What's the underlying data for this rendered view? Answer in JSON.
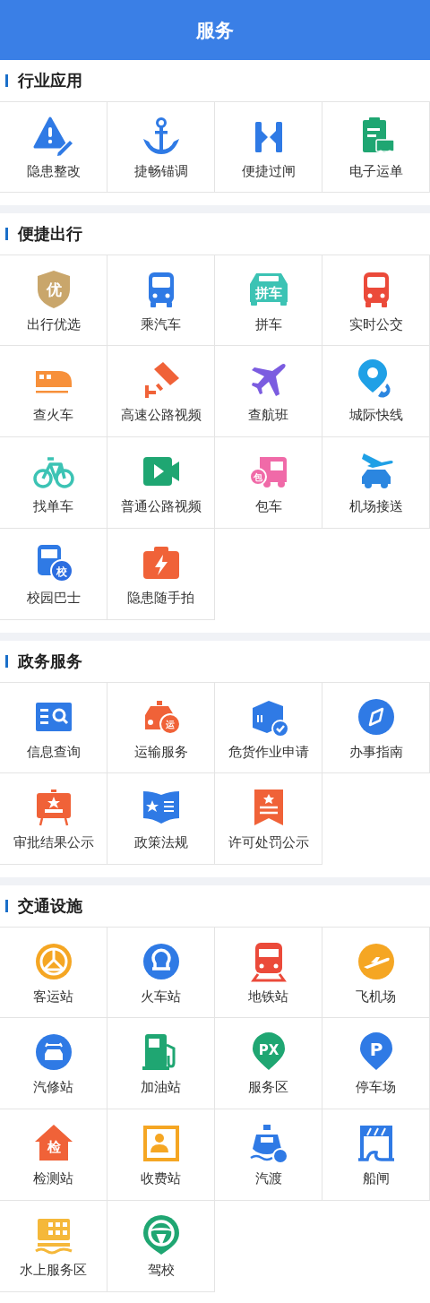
{
  "header": {
    "title": "服务"
  },
  "sections": [
    {
      "title": "行业应用",
      "items": [
        {
          "label": "隐患整改"
        },
        {
          "label": "捷畅锚调"
        },
        {
          "label": "便捷过闸"
        },
        {
          "label": "电子运单"
        }
      ]
    },
    {
      "title": "便捷出行",
      "items": [
        {
          "label": "出行优选",
          "badge": "优"
        },
        {
          "label": "乘汽车"
        },
        {
          "label": "拼车",
          "badge": "拼车"
        },
        {
          "label": "实时公交"
        },
        {
          "label": "查火车"
        },
        {
          "label": "高速公路视频"
        },
        {
          "label": "查航班"
        },
        {
          "label": "城际快线"
        },
        {
          "label": "找单车"
        },
        {
          "label": "普通公路视频"
        },
        {
          "label": "包车",
          "badge": "包"
        },
        {
          "label": "机场接送"
        },
        {
          "label": "校园巴士",
          "badge": "校"
        },
        {
          "label": "隐患随手拍"
        }
      ]
    },
    {
      "title": "政务服务",
      "items": [
        {
          "label": "信息查询"
        },
        {
          "label": "运输服务",
          "badge": "运"
        },
        {
          "label": "危货作业申请"
        },
        {
          "label": "办事指南"
        },
        {
          "label": "审批结果公示"
        },
        {
          "label": "政策法规"
        },
        {
          "label": "许可处罚公示"
        }
      ]
    },
    {
      "title": "交通设施",
      "items": [
        {
          "label": "客运站"
        },
        {
          "label": "火车站"
        },
        {
          "label": "地铁站"
        },
        {
          "label": "飞机场"
        },
        {
          "label": "汽修站"
        },
        {
          "label": "加油站"
        },
        {
          "label": "服务区",
          "badge": "PX"
        },
        {
          "label": "停车场",
          "badge": "P"
        },
        {
          "label": "检测站",
          "badge": "检"
        },
        {
          "label": "收费站"
        },
        {
          "label": "汽渡"
        },
        {
          "label": "船闸"
        },
        {
          "label": "水上服务区"
        },
        {
          "label": "驾校"
        }
      ]
    }
  ]
}
